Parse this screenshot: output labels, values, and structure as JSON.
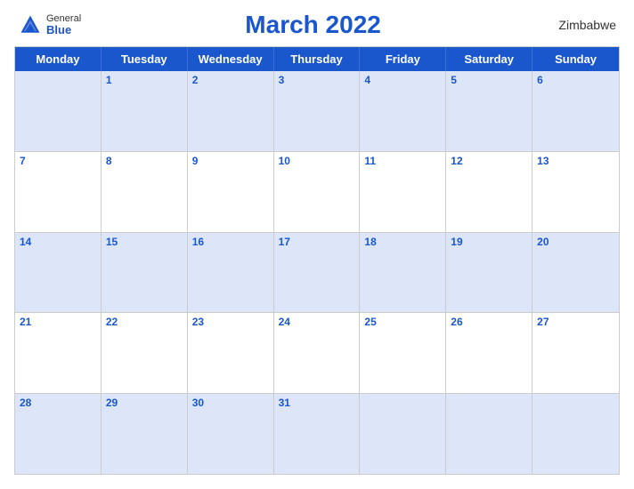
{
  "header": {
    "title": "March 2022",
    "country": "Zimbabwe",
    "logo": {
      "general": "General",
      "blue": "Blue"
    }
  },
  "days_of_week": [
    "Monday",
    "Tuesday",
    "Wednesday",
    "Thursday",
    "Friday",
    "Saturday",
    "Sunday"
  ],
  "weeks": [
    [
      null,
      1,
      2,
      3,
      4,
      5,
      6
    ],
    [
      7,
      8,
      9,
      10,
      11,
      12,
      13
    ],
    [
      14,
      15,
      16,
      17,
      18,
      19,
      20
    ],
    [
      21,
      22,
      23,
      24,
      25,
      26,
      27
    ],
    [
      28,
      29,
      30,
      31,
      null,
      null,
      null
    ]
  ]
}
